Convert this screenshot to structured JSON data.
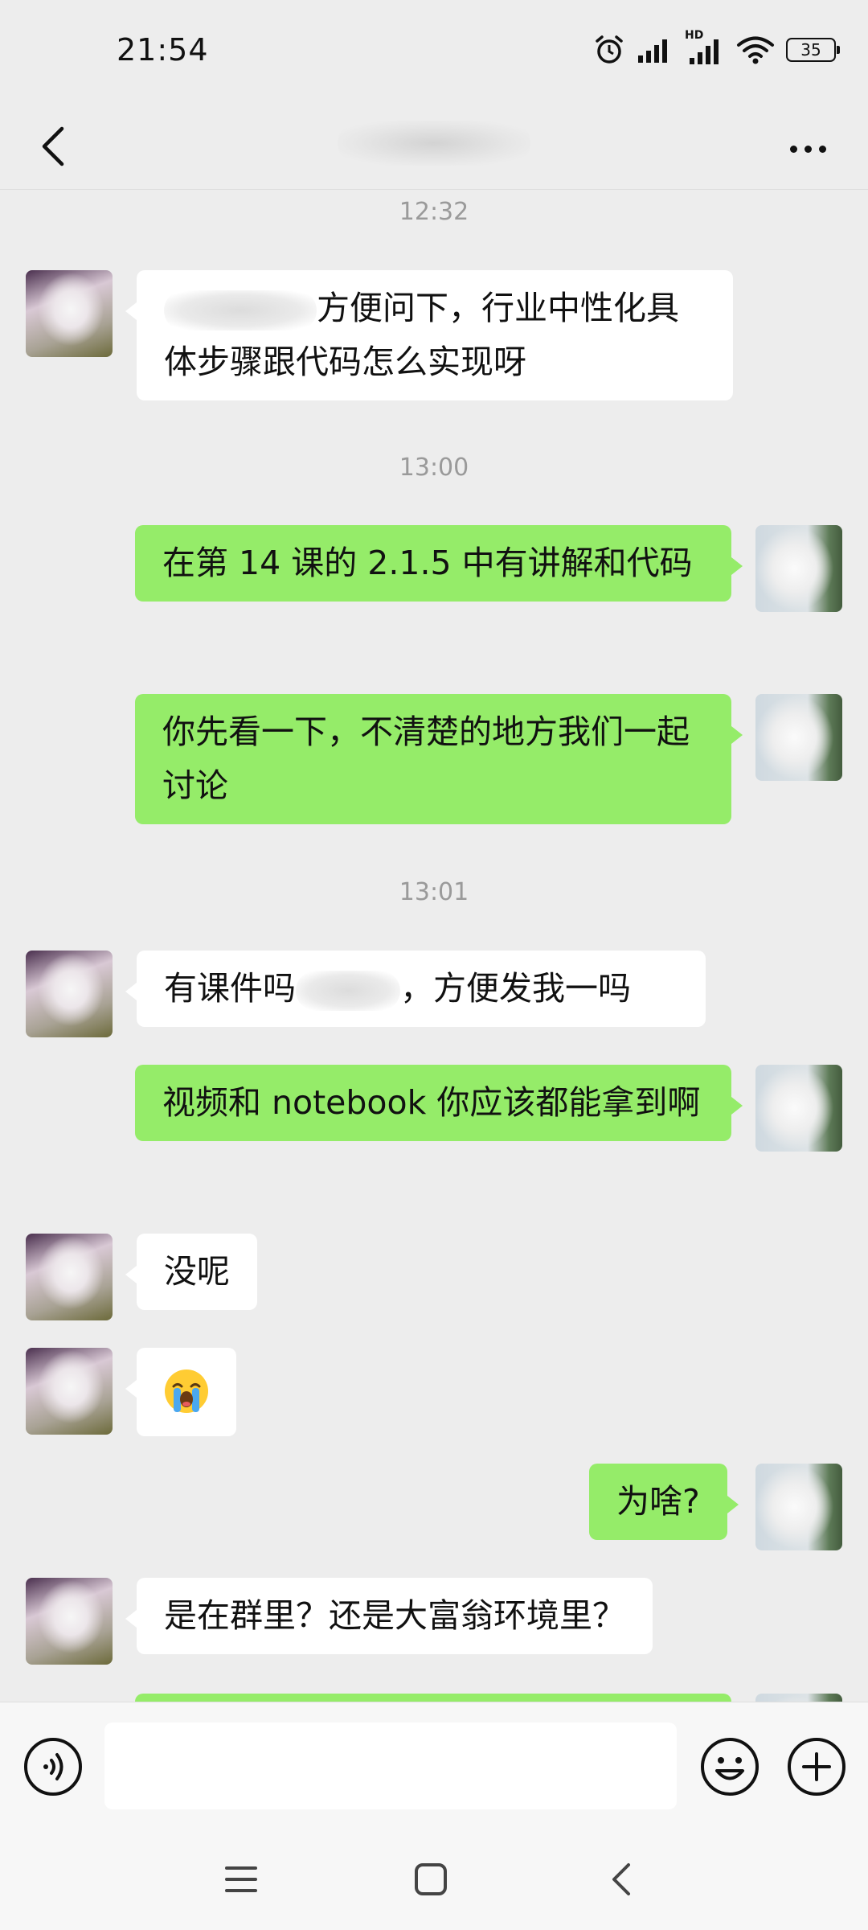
{
  "status_bar": {
    "time": "21:54",
    "network_label": "HD",
    "battery": "35",
    "icons": [
      "alarm-icon",
      "signal-icon",
      "hd-signal-icon",
      "wifi-icon",
      "battery-icon"
    ]
  },
  "header": {
    "back_icon": "chevron-left-icon",
    "more_icon": "more-dots-icon"
  },
  "messages": [
    {
      "type": "timestamp",
      "text": "12:32"
    },
    {
      "type": "in",
      "blurred_prefix": true,
      "text": "方便问下，行业中性化具体步骤跟代码怎么实现呀"
    },
    {
      "type": "timestamp",
      "text": "13:00"
    },
    {
      "type": "out",
      "text": "在第 14 课的 2.1.5 中有讲解和代码"
    },
    {
      "type": "out",
      "text": "你先看一下，不清楚的地方我们一起讨论"
    },
    {
      "type": "timestamp",
      "text": "13:01"
    },
    {
      "type": "in",
      "text_before": "有课件吗",
      "text_after": "，方便发我一吗"
    },
    {
      "type": "out",
      "text": "视频和 notebook 你应该都能拿到啊"
    },
    {
      "type": "in",
      "text": "没呢"
    },
    {
      "type": "in",
      "emoji": "loudly-crying-face"
    },
    {
      "type": "out",
      "text": "为啥?"
    },
    {
      "type": "in",
      "text": "是在群里？还是大富翁环境里？"
    }
  ],
  "input_bar": {
    "voice_icon": "voice-icon",
    "text_value": "",
    "emoji_icon": "smiley-icon",
    "plus_icon": "plus-circle-icon"
  },
  "nav_bar": {
    "icons": [
      "menu-icon",
      "home-square-icon",
      "back-triangle-icon"
    ]
  },
  "colors": {
    "background": "#ededed",
    "bubble_out": "#95ec69",
    "bubble_in": "#ffffff",
    "timestamp": "#9a9a9a"
  }
}
